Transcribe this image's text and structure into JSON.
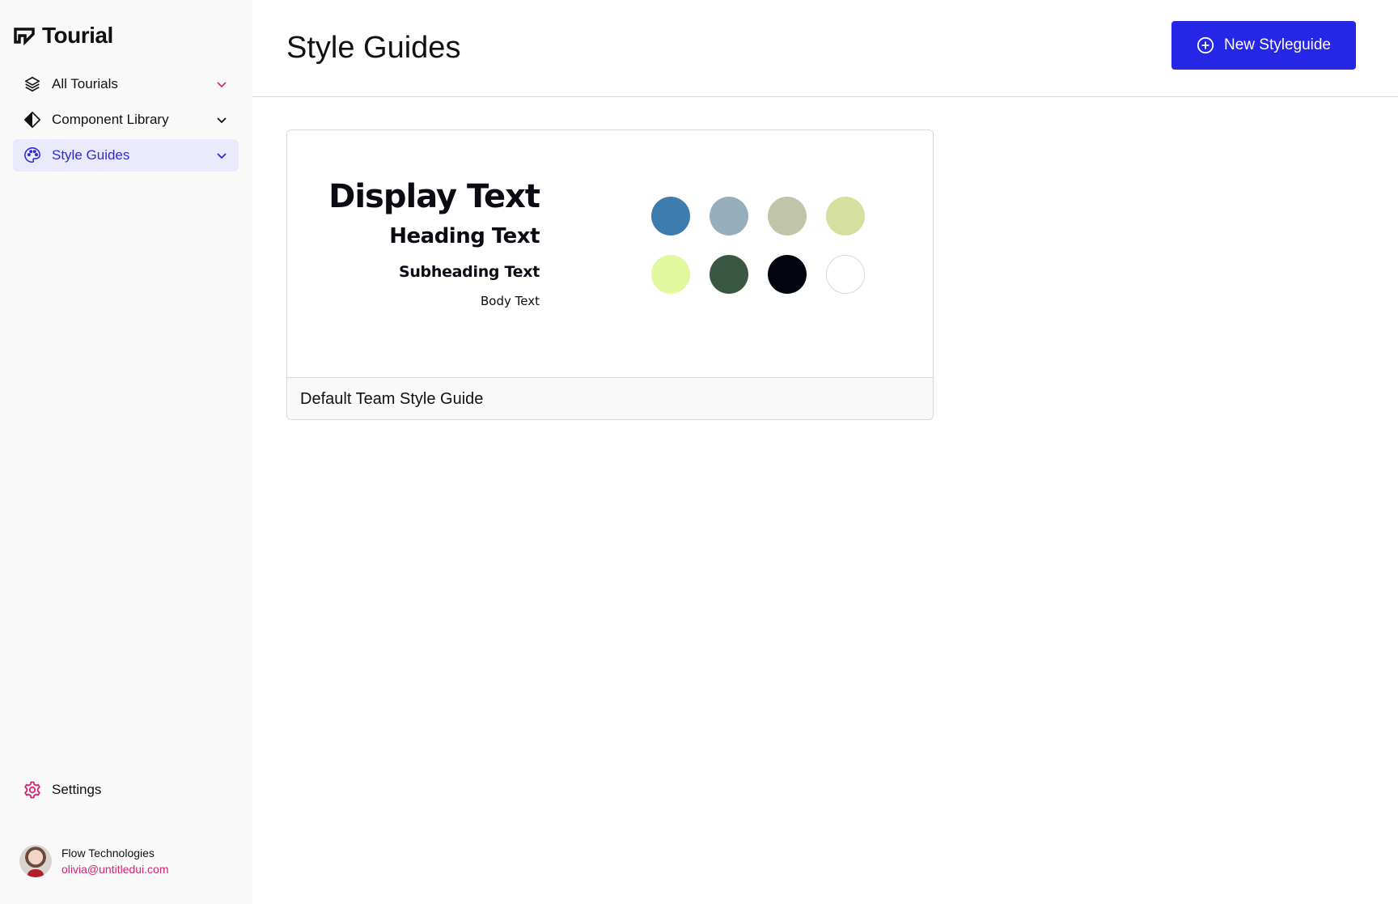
{
  "app": {
    "name": "Tourial"
  },
  "sidebar": {
    "items": [
      {
        "label": "All Tourials",
        "icon": "layers-icon",
        "chevron_color": "#d6246e",
        "active": false
      },
      {
        "label": "Component Library",
        "icon": "component-icon",
        "chevron_color": "#111111",
        "active": false
      },
      {
        "label": "Style Guides",
        "icon": "palette-icon",
        "chevron_color": "#2b2bd9",
        "active": true
      }
    ],
    "settings_label": "Settings",
    "account": {
      "name": "Flow Technologies",
      "email": "olivia@untitledui.com"
    }
  },
  "header": {
    "title": "Style Guides",
    "new_button_label": "New Styleguide"
  },
  "style_guides": [
    {
      "title": "Default Team Style Guide",
      "typography": {
        "display": "Display Text",
        "heading": "Heading Text",
        "subheading": "Subheading Text",
        "body": "Body Text"
      },
      "colors": [
        "#3e7cad",
        "#97afbd",
        "#c0c5a9",
        "#d5e0a0",
        "#e2f89f",
        "#3a5744",
        "#02050f",
        "#ffffff"
      ]
    }
  ],
  "theme": {
    "accent": "#2626e6",
    "active_bg": "#ebeafc",
    "active_text": "#2b2bd9",
    "pink": "#d6246e"
  }
}
